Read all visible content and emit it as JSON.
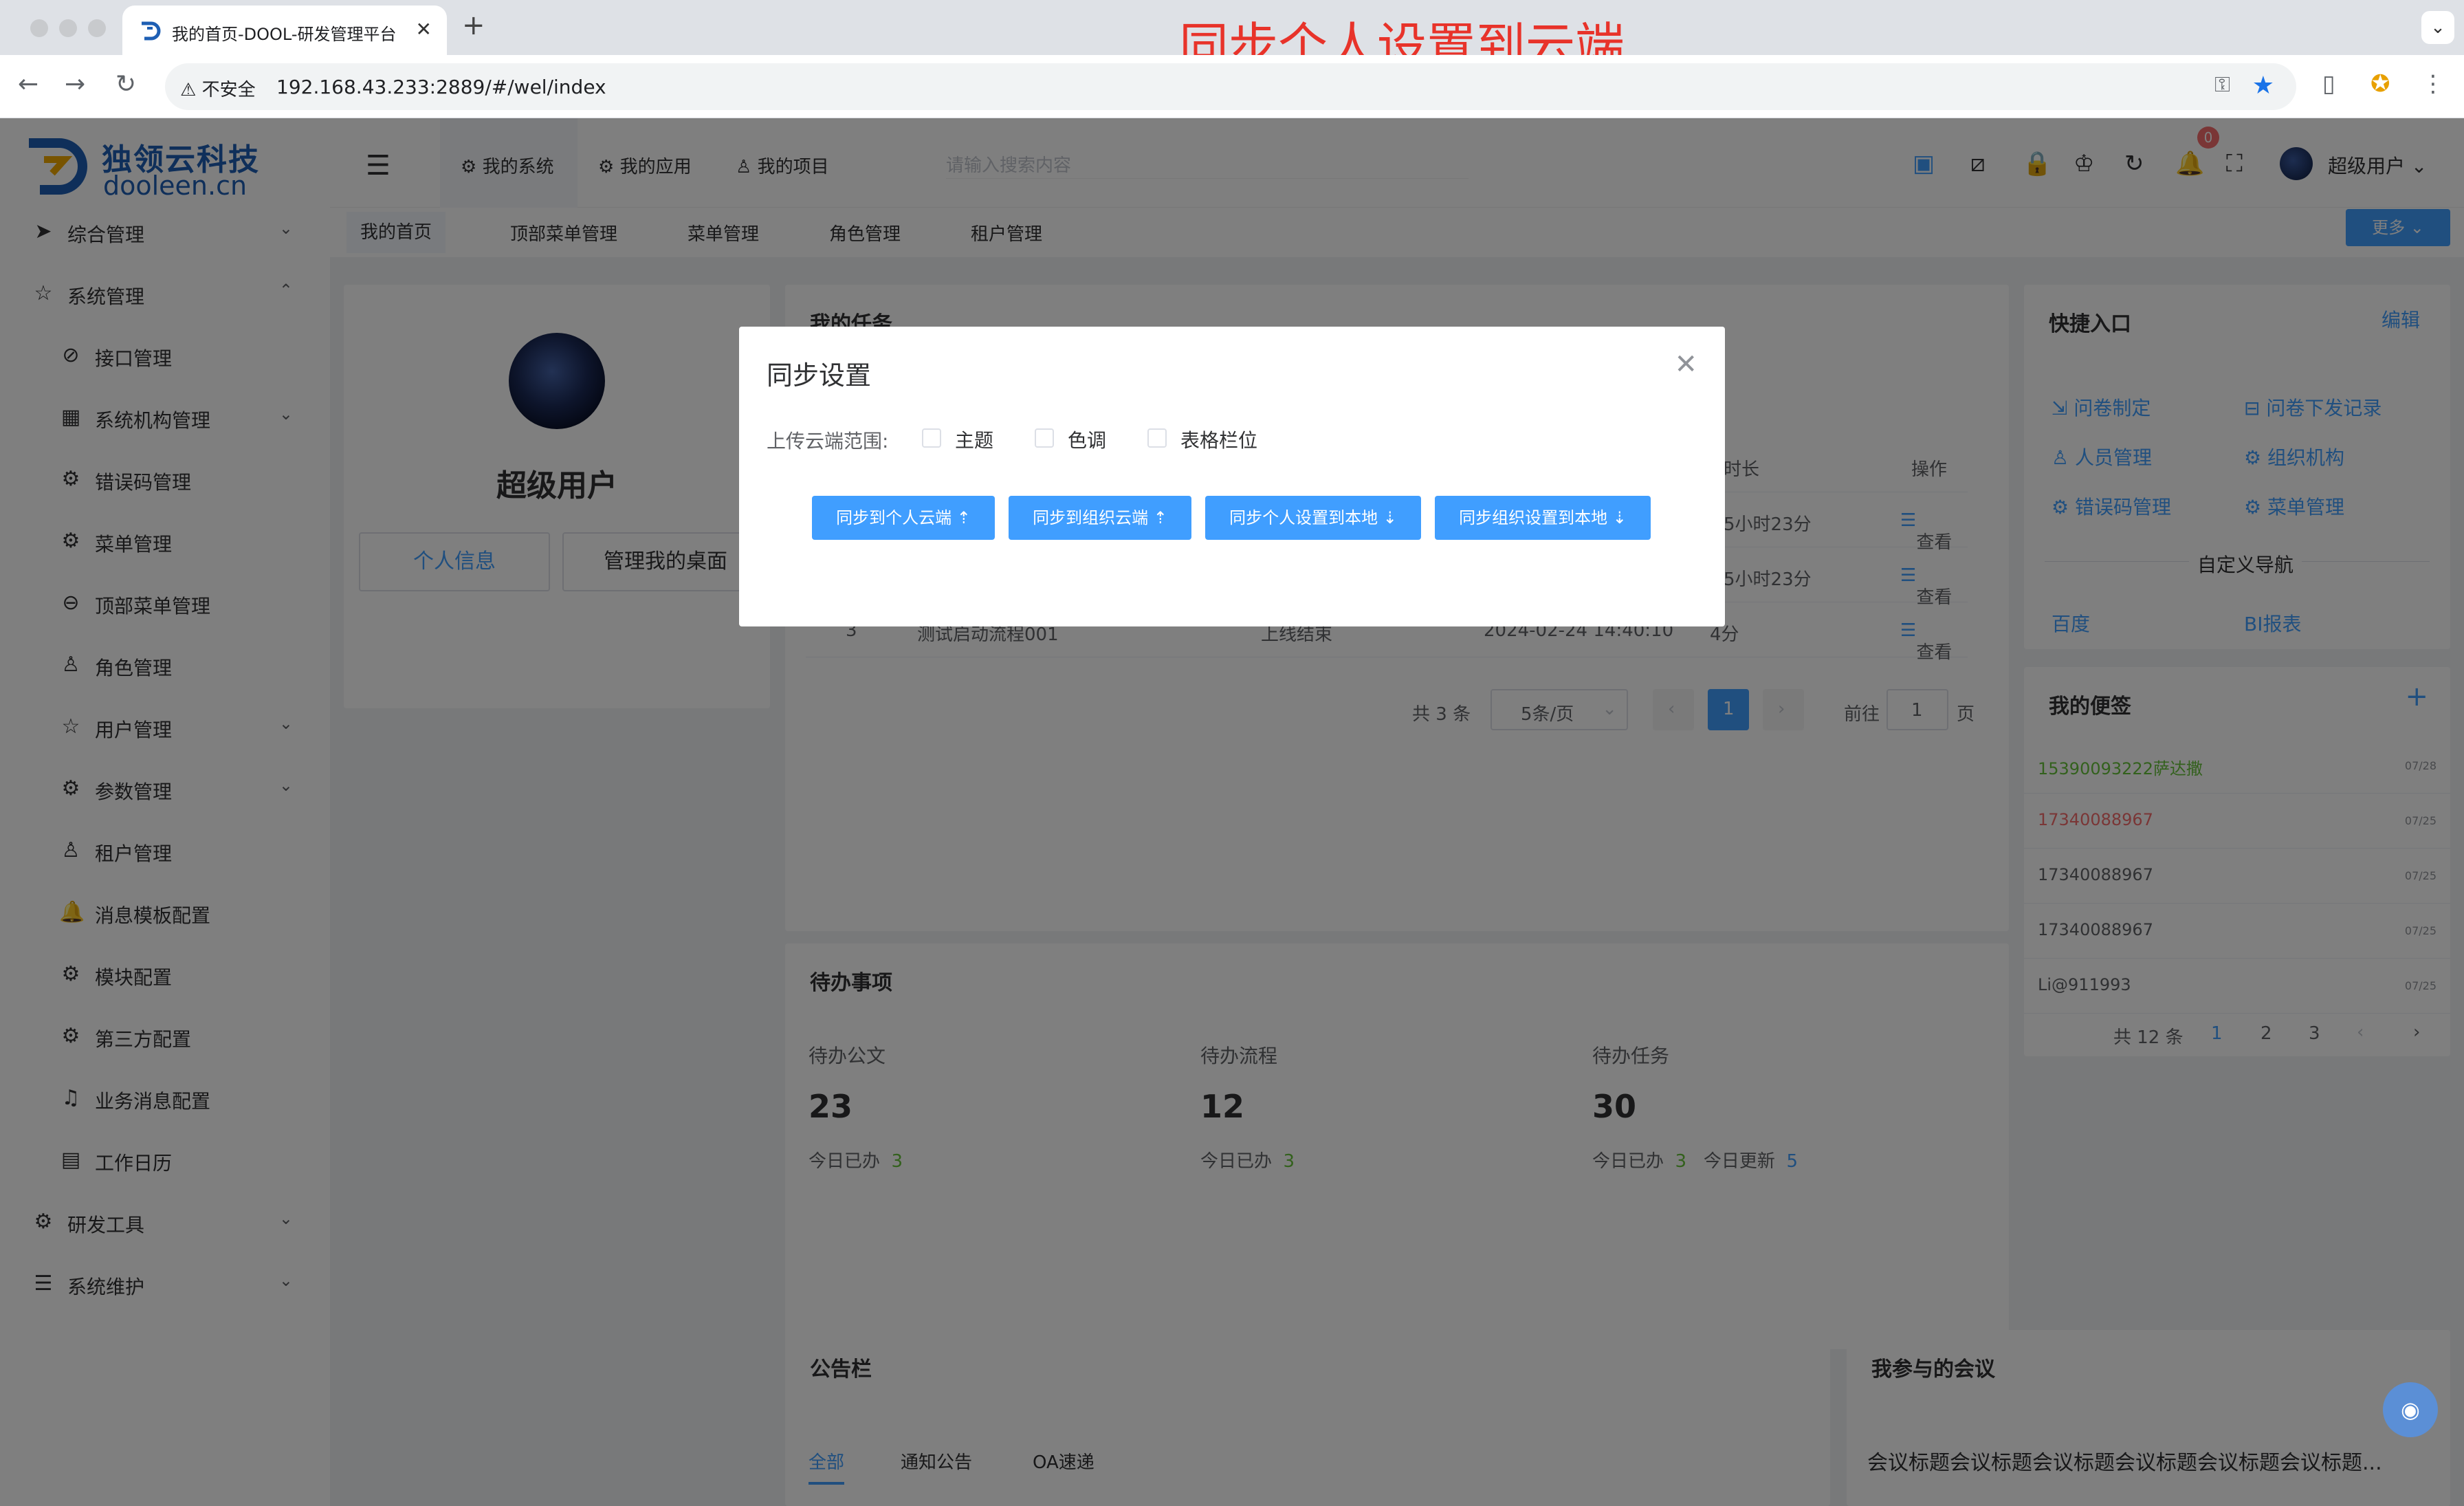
{
  "browser": {
    "tab_title": "我的首页-DOOL-研发管理平台",
    "insecure_label": "不安全",
    "url": "192.168.43.233:2889/#/wel/index",
    "caption": "同步个人设置到云端"
  },
  "logo": {
    "cn": "独领云科技",
    "en": "dooleen.cn"
  },
  "sidebar": {
    "items": [
      {
        "label": "综合管理",
        "icon": "paper-plane-icon"
      },
      {
        "label": "系统管理",
        "icon": "star-icon"
      },
      {
        "label": "接口管理",
        "icon": "api-icon"
      },
      {
        "label": "系统机构管理",
        "icon": "grid-icon"
      },
      {
        "label": "错误码管理",
        "icon": "gear-icon"
      },
      {
        "label": "菜单管理",
        "icon": "settings-icon"
      },
      {
        "label": "顶部菜单管理",
        "icon": "search-minus-icon"
      },
      {
        "label": "角色管理",
        "icon": "user-icon"
      },
      {
        "label": "用户管理",
        "icon": "star-icon"
      },
      {
        "label": "参数管理",
        "icon": "settings-icon"
      },
      {
        "label": "租户管理",
        "icon": "user-icon"
      },
      {
        "label": "消息模板配置",
        "icon": "bell-icon"
      },
      {
        "label": "模块配置",
        "icon": "settings-icon"
      },
      {
        "label": "第三方配置",
        "icon": "settings-icon"
      },
      {
        "label": "业务消息配置",
        "icon": "bell-outline-icon"
      },
      {
        "label": "工作日历",
        "icon": "calendar-icon"
      },
      {
        "label": "研发工具",
        "icon": "tools-icon"
      },
      {
        "label": "系统维护",
        "icon": "sliders-icon"
      }
    ]
  },
  "topnav": {
    "tabs": [
      "我的系统",
      "我的应用",
      "我的项目"
    ],
    "search_placeholder": "请输入搜索内容",
    "badge": "0",
    "user": "超级用户"
  },
  "tags": [
    "我的首页",
    "顶部菜单管理",
    "菜单管理",
    "角色管理",
    "租户管理"
  ],
  "more_label": "更多",
  "profile": {
    "name": "超级用户",
    "btn_info": "个人信息",
    "btn_desktop": "管理我的桌面"
  },
  "tasks": {
    "title": "我的任务",
    "col_duration": "时长",
    "col_action": "操作",
    "rows": [
      {
        "no": "",
        "name": "",
        "status": "",
        "time": "",
        "duration": "5小时23分",
        "action": "查看"
      },
      {
        "no": "",
        "name": "",
        "status": "",
        "time": "",
        "duration": "5小时23分",
        "action": "查看"
      },
      {
        "no": "3",
        "name": "测试启动流程001",
        "status": "上线结束",
        "time": "2024-02-24 14:40:10",
        "duration": "4分",
        "action": "查看"
      }
    ],
    "pager": {
      "total": "共 3 条",
      "size": "5条/页",
      "page": "1",
      "goto": "前往",
      "goto_val": "1",
      "page_unit": "页"
    }
  },
  "todo": {
    "title": "待办事项",
    "items": [
      {
        "label": "待办公文",
        "num": "23",
        "done_label": "今日已办",
        "done": "3"
      },
      {
        "label": "待办流程",
        "num": "12",
        "done_label": "今日已办",
        "done": "3"
      },
      {
        "label": "待办任务",
        "num": "30",
        "done_label": "今日已办",
        "done": "3",
        "upd_label": "今日更新",
        "upd": "5"
      }
    ]
  },
  "notice": {
    "title": "公告栏",
    "tabs": [
      "全部",
      "通知公告",
      "OA速递"
    ]
  },
  "meeting": {
    "title": "我参与的会议",
    "text": "会议标题会议标题会议标题会议标题会议标题会议标题..."
  },
  "quick": {
    "title": "快捷入口",
    "edit": "编辑",
    "links": [
      "问卷制定",
      "问卷下发记录",
      "人员管理",
      "组织机构",
      "错误码管理",
      "菜单管理"
    ],
    "custom_title": "自定义导航",
    "custom": [
      "百度",
      "BI报表"
    ]
  },
  "notes": {
    "title": "我的便签",
    "add": "+",
    "items": [
      {
        "text": "15390093222萨达撒",
        "date": "07/28",
        "color": "#67c23a"
      },
      {
        "text": "17340088967",
        "date": "07/25",
        "color": "#f56c6c"
      },
      {
        "text": "17340088967",
        "date": "07/25",
        "color": "#606266"
      },
      {
        "text": "17340088967",
        "date": "07/25",
        "color": "#606266"
      },
      {
        "text": "Li@911993",
        "date": "07/25",
        "color": "#606266"
      }
    ],
    "pager": {
      "total": "共 12 条",
      "p1": "1",
      "p2": "2",
      "p3": "3"
    }
  },
  "modal": {
    "title": "同步设置",
    "scope_label": "上传云端范围:",
    "options": [
      "主题",
      "色调",
      "表格栏位"
    ],
    "buttons": [
      "同步到个人云端 ⇡",
      "同步到组织云端 ⇡",
      "同步个人设置到本地 ⇣",
      "同步组织设置到本地 ⇣"
    ]
  },
  "colors": {
    "primary": "#409eff",
    "danger": "#f56c6c",
    "success": "#67c23a",
    "brand": "#1e5fb4"
  }
}
